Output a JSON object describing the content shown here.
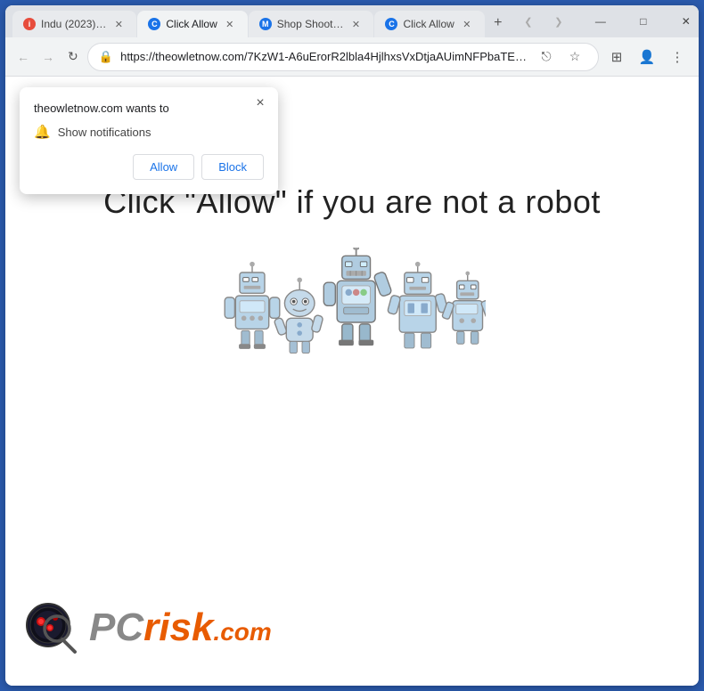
{
  "browser": {
    "tabs": [
      {
        "id": "tab1",
        "label": "Indu (2023)…",
        "favicon": "circle-i",
        "active": false
      },
      {
        "id": "tab2",
        "label": "Click Allow",
        "favicon": "circle-c",
        "active": true
      },
      {
        "id": "tab3",
        "label": "Shop Shoot…",
        "favicon": "M",
        "active": false
      },
      {
        "id": "tab4",
        "label": "Click Allow",
        "favicon": "circle-c2",
        "active": false
      }
    ],
    "url": "https://theowletnow.com/7KzW1-A6uErorR2lbla4HjlhxsVxDtjaAUimNFPbaTE…",
    "new_tab_symbol": "+",
    "nav": {
      "back_symbol": "←",
      "forward_symbol": "→",
      "refresh_symbol": "↻"
    },
    "window_controls": {
      "minimize": "—",
      "maximize": "□",
      "close": "✕"
    }
  },
  "notification_popup": {
    "title": "theowletnow.com wants to",
    "notification_label": "Show notifications",
    "allow_label": "Allow",
    "block_label": "Block",
    "close_symbol": "×"
  },
  "page": {
    "main_text": "Click \"Allow\"   if you are not   a robot"
  },
  "pcrisk": {
    "pc_text": "PC",
    "risk_text": "risk",
    "dot_com": ".com"
  },
  "icons": {
    "lock": "🔒",
    "bell": "🔔",
    "share": "⎋",
    "star": "☆",
    "extensions": "⊞",
    "profile": "👤",
    "menu": "⋮",
    "search_icon": "🔍"
  }
}
